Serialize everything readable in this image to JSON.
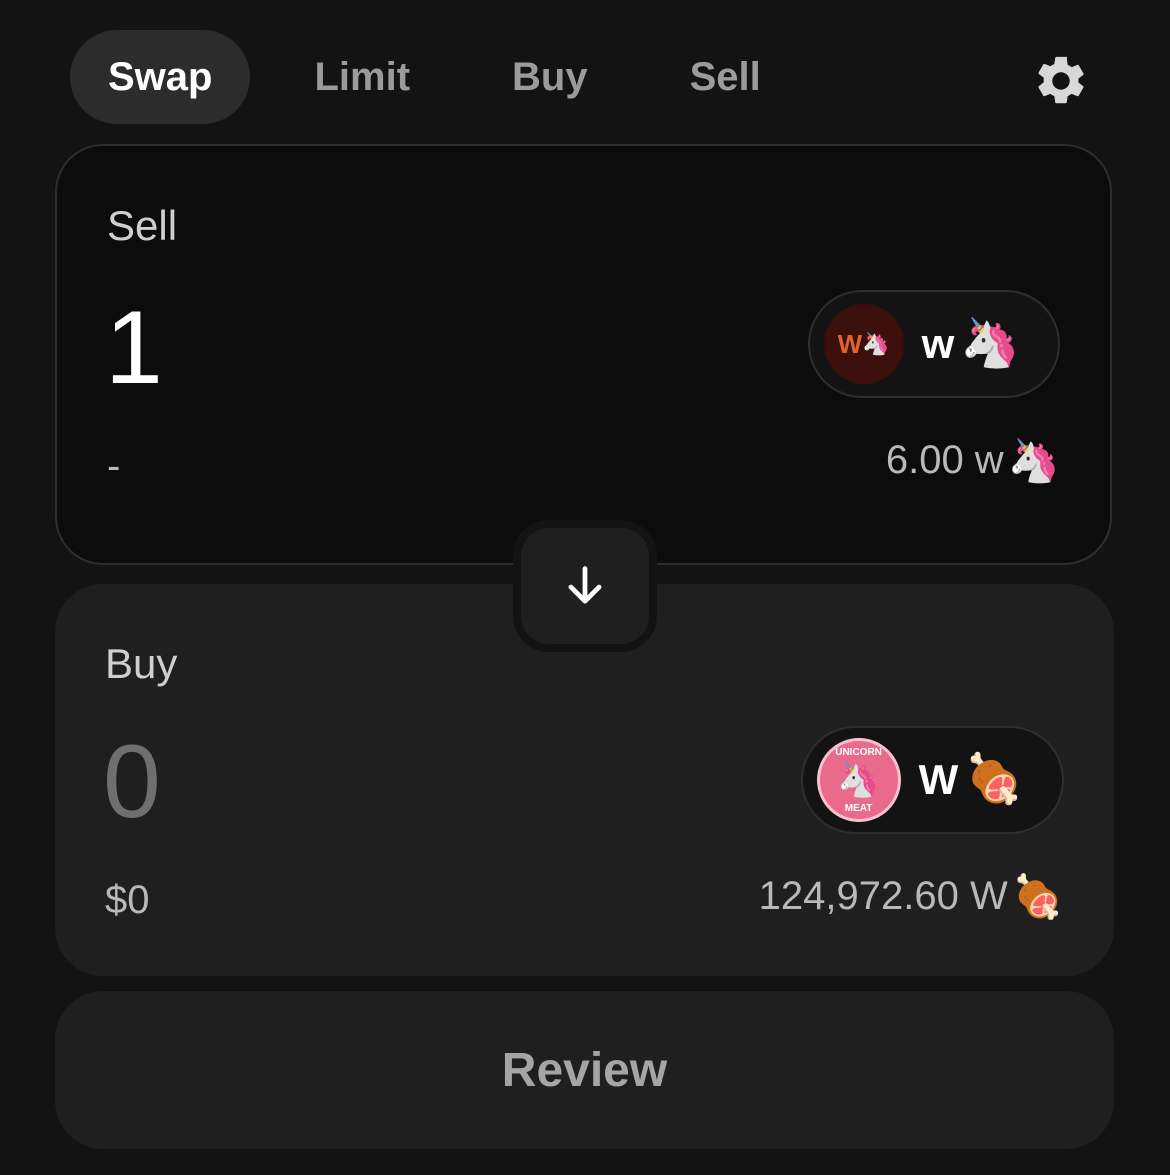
{
  "tabs": [
    {
      "label": "Swap"
    },
    {
      "label": "Limit"
    },
    {
      "label": "Buy"
    },
    {
      "label": "Sell"
    }
  ],
  "sell": {
    "label": "Sell",
    "amount": "1",
    "usd_value": "-",
    "token": {
      "logo_text": "W",
      "symbol": "w",
      "emoji": "🦄"
    },
    "balance": {
      "amount": "6.00 w",
      "emoji": "🦄"
    }
  },
  "buy": {
    "label": "Buy",
    "amount": "0",
    "usd_value": "$0",
    "token": {
      "logo_text_top": "UNICORN",
      "logo_text_bottom": "MEAT",
      "symbol": "W",
      "emoji": "🍖"
    },
    "balance": {
      "amount": "124,972.60 W",
      "emoji": "🍖"
    }
  },
  "review_label": "Review",
  "colors": {
    "background": "#131313",
    "panel": "#1f1f1f",
    "active_tab": "#2c2c2c",
    "sell_logo_bg": "#3a0f0c",
    "buy_logo_bg": "#e96a8a"
  }
}
